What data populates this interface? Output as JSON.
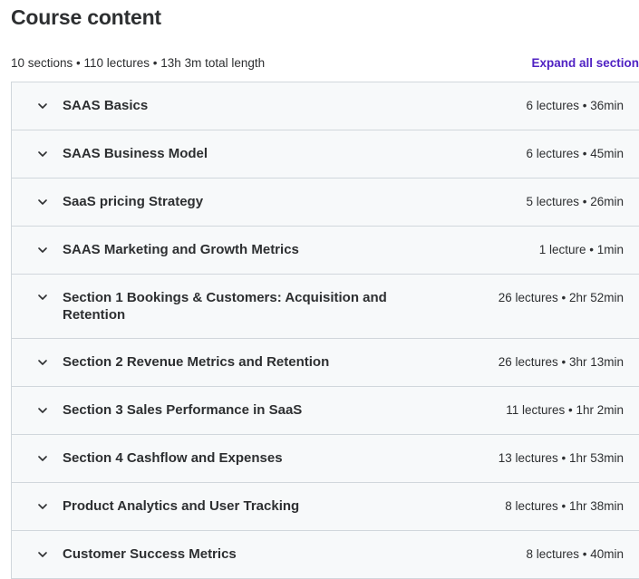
{
  "page": {
    "title": "Course content",
    "summary": "10 sections • 110 lectures • 13h 3m total length",
    "expand_label": "Expand all section"
  },
  "icons": {
    "section_toggle": "chevron-down-icon"
  },
  "colors": {
    "accent": "#5022c3",
    "text": "#2d2f31",
    "row_bg": "#f7f9fa",
    "border": "#d1d7dc"
  },
  "sections": [
    {
      "title": "SAAS Basics",
      "meta": "6 lectures • 36min"
    },
    {
      "title": "SAAS Business Model",
      "meta": "6 lectures • 45min"
    },
    {
      "title": "SaaS pricing Strategy",
      "meta": "5 lectures • 26min"
    },
    {
      "title": "SAAS Marketing and Growth Metrics",
      "meta": "1 lecture • 1min"
    },
    {
      "title": "Section 1 Bookings & Customers: Acquisition and Retention",
      "meta": "26 lectures • 2hr 52min"
    },
    {
      "title": "Section 2 Revenue Metrics and Retention",
      "meta": "26 lectures • 3hr 13min"
    },
    {
      "title": "Section 3 Sales Performance in SaaS",
      "meta": "11 lectures • 1hr 2min"
    },
    {
      "title": "Section 4 Cashflow and Expenses",
      "meta": "13 lectures • 1hr 53min"
    },
    {
      "title": "Product Analytics and User Tracking",
      "meta": "8 lectures • 1hr 38min"
    },
    {
      "title": "Customer Success Metrics",
      "meta": "8 lectures • 40min"
    }
  ]
}
